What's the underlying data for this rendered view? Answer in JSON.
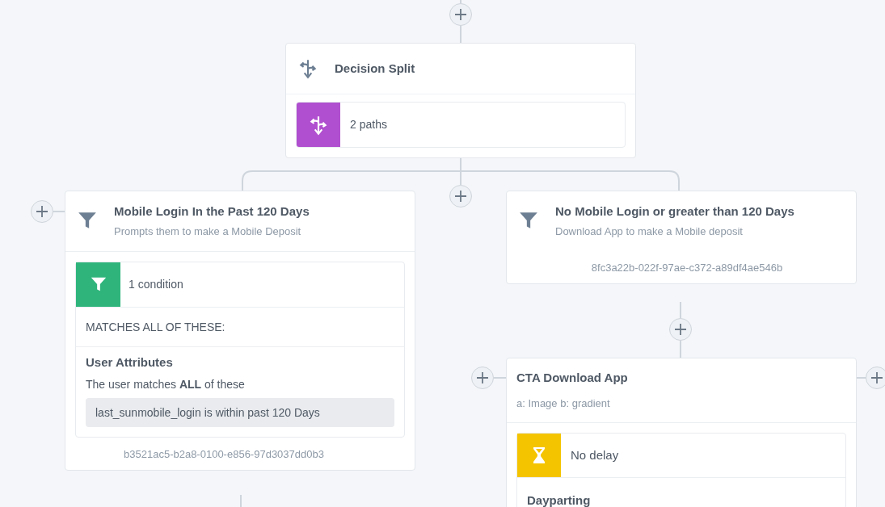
{
  "decision_split": {
    "title": "Decision Split",
    "summary": "2 paths"
  },
  "branches": [
    {
      "kind": "filter",
      "title": "Mobile Login In the Past 120 Days",
      "subtitle": "Prompts them to make a Mobile Deposit",
      "condition": {
        "label": "1 condition",
        "match": "MATCHES ALL OF THESE:",
        "group_title": "User Attributes",
        "group_text": "The user matches **ALL** of these",
        "rule": "last_sunmobile_login is within past 120 Days"
      },
      "id_text": "b3521ac5-b2a8-0100-e856-97d3037dd0b3"
    },
    {
      "kind": "filter",
      "title": "No Mobile Login or greater than 120 Days",
      "subtitle": "Download App to make a Mobile deposit",
      "id_text": "8fc3a22b-022f-97ae-c372-a89df4ae546b"
    }
  ],
  "message_step": {
    "title": "CTA Download App",
    "subtitle": "a: Image b: gradient",
    "delay": {
      "label": "No delay",
      "section": "Dayparting"
    }
  }
}
